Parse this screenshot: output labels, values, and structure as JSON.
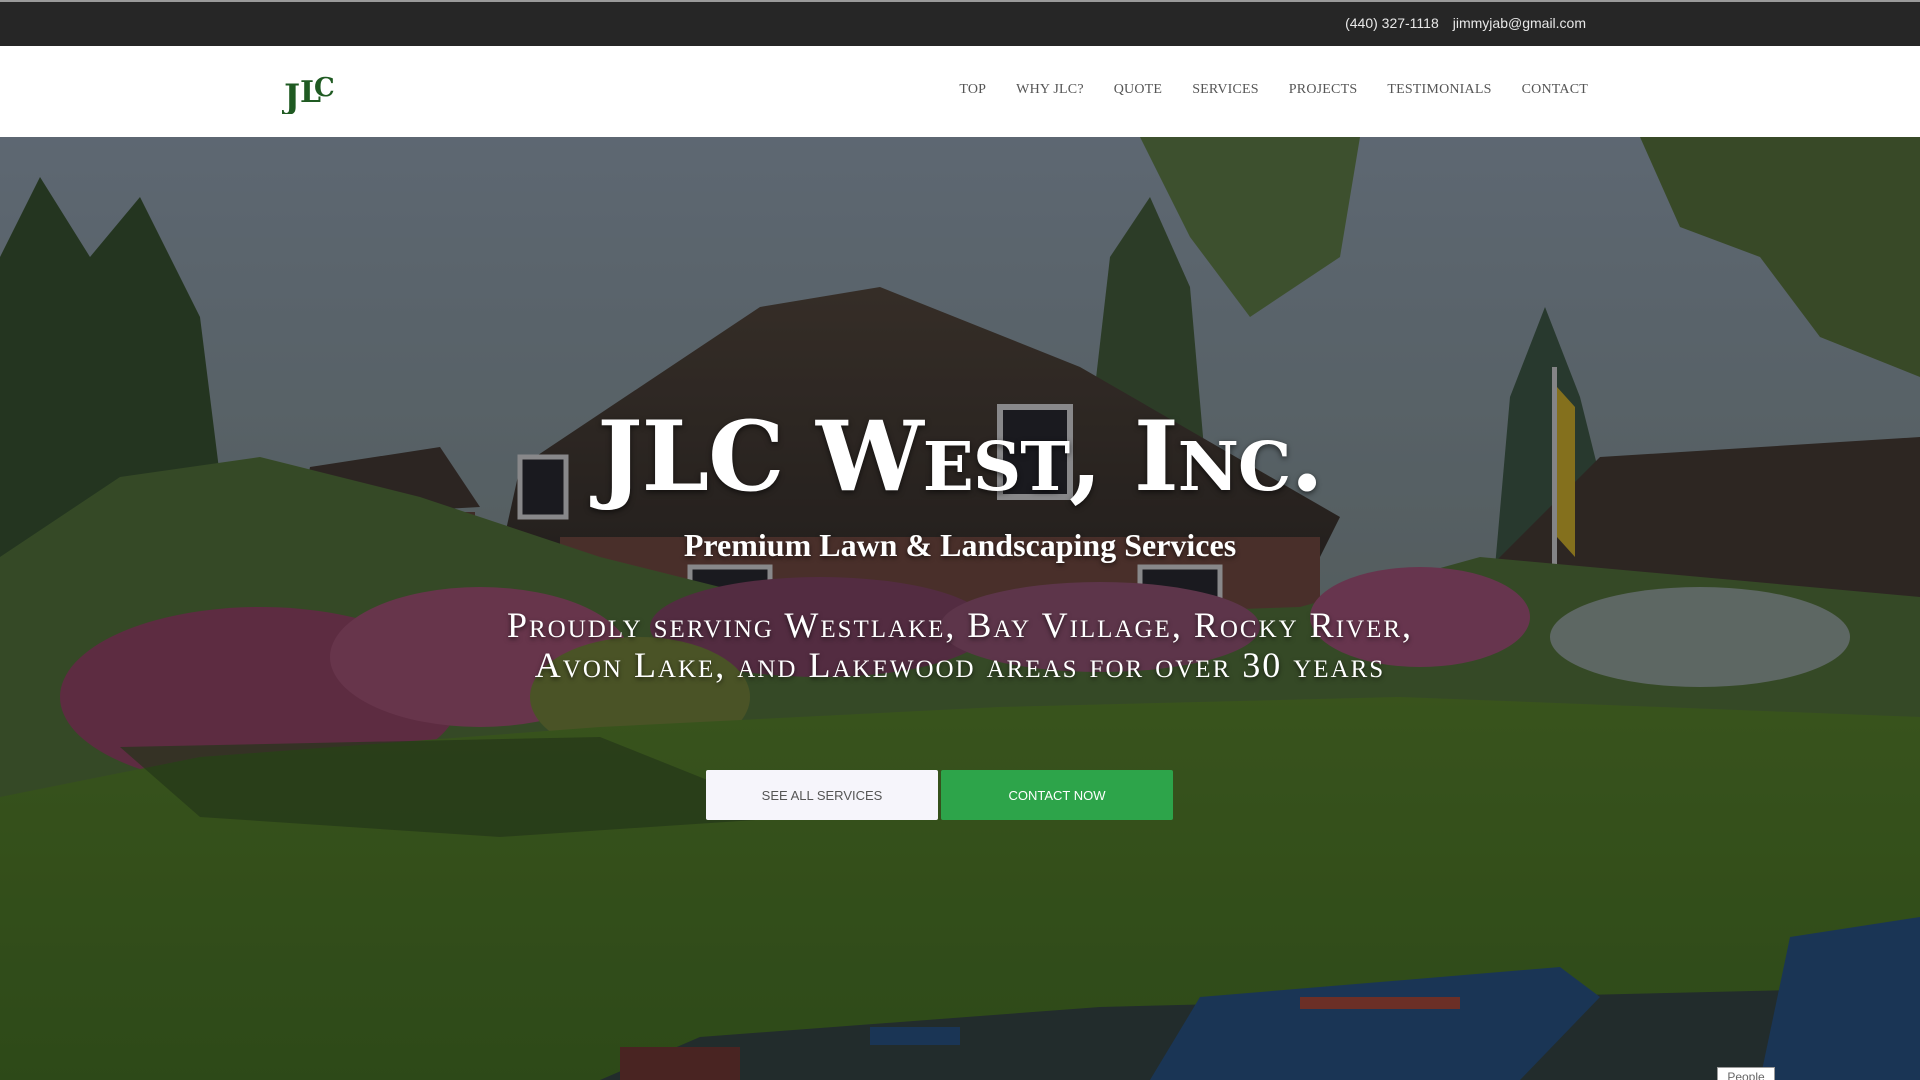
{
  "topbar": {
    "phone": "(440) 327-1118",
    "email": "jimmyjab@gmail.com"
  },
  "brand": {
    "logo_text": "JLC"
  },
  "nav": {
    "items": [
      "TOP",
      "WHY JLC?",
      "QUOTE",
      "SERVICES",
      "PROJECTS",
      "TESTIMONIALS",
      "CONTACT"
    ]
  },
  "hero": {
    "title": "JLC West, Inc.",
    "subtitle": "Premium Lawn & Landscaping Services",
    "serving_line1": "Proudly serving Westlake, Bay Village, Rocky River,",
    "serving_line2": "Avon Lake, and Lakewood areas for over 30 years",
    "see_all_label": "SEE ALL SERVICES",
    "contact_label": "CONTACT NOW",
    "image_tag": "People"
  },
  "colors": {
    "topbar_bg": "#262626",
    "accent_green": "#2da44a",
    "logo_green": "#1f5a22"
  }
}
